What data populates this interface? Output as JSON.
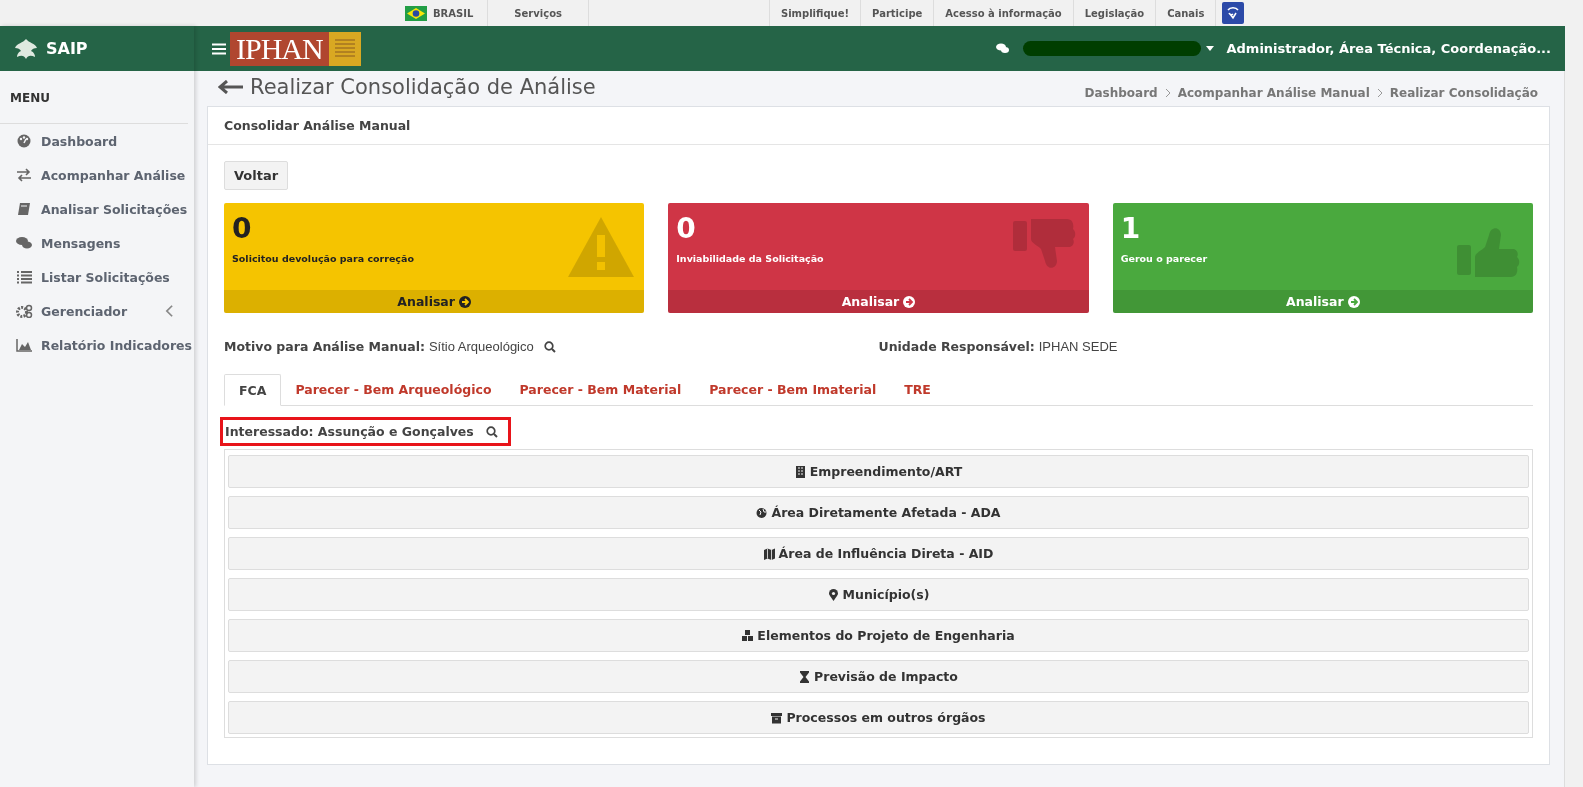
{
  "gov_bar": {
    "country": "BRASIL",
    "links": [
      "Serviços",
      "Simplifique!",
      "Participe",
      "Acesso à informação",
      "Legislação",
      "Canais"
    ]
  },
  "sidebar": {
    "brand": "SAIP",
    "menu_title": "MENU",
    "items": [
      {
        "label": "Dashboard"
      },
      {
        "label": "Acompanhar Análise"
      },
      {
        "label": "Analisar Solicitações"
      },
      {
        "label": "Mensagens"
      },
      {
        "label": "Listar Solicitações"
      },
      {
        "label": "Gerenciador",
        "has_submenu": true
      },
      {
        "label": "Relatório Indicadores"
      }
    ]
  },
  "header": {
    "logo_text": "IPHAN",
    "user_roles": "Administrador, Área Técnica, Coordenação..."
  },
  "page": {
    "title": "Realizar Consolidação de Análise",
    "breadcrumb": [
      "Dashboard",
      "Acompanhar Análise Manual",
      "Realizar Consolidação"
    ]
  },
  "panel": {
    "title": "Consolidar Análise Manual",
    "back_button": "Voltar",
    "cards": [
      {
        "count": "0",
        "label": "Solicitou devolução para correção",
        "action": "Analisar",
        "color": "#f5c400",
        "dark_text": true
      },
      {
        "count": "0",
        "label": "Inviabilidade da Solicitação",
        "action": "Analisar",
        "color": "#cf3546",
        "dark_text": false
      },
      {
        "count": "1",
        "label": "Gerou o parecer",
        "action": "Analisar",
        "color": "#4aa93e",
        "dark_text": false
      }
    ],
    "info": [
      {
        "label": "Motivo para Análise Manual:",
        "value": "Sítio Arqueológico",
        "searchable": true
      },
      {
        "label": "Unidade Responsável:",
        "value": "IPHAN SEDE",
        "searchable": false
      }
    ],
    "tabs": [
      {
        "label": "FCA",
        "selected": true
      },
      {
        "label": "Parecer - Bem Arqueológico",
        "selected": false
      },
      {
        "label": "Parecer - Bem Material",
        "selected": false
      },
      {
        "label": "Parecer - Bem Imaterial",
        "selected": false
      },
      {
        "label": "TRE",
        "selected": false
      }
    ],
    "interessado": {
      "text": "Interessado: Assunção e Gonçalves",
      "highlighted": true
    },
    "sections": [
      "Empreendimento/ART",
      "Área Diretamente Afetada - ADA",
      "Área de Influência Direta - AID",
      "Município(s)",
      "Elementos do Projeto de Engenharia",
      "Previsão de Impacto",
      "Processos em outros órgãos"
    ]
  }
}
